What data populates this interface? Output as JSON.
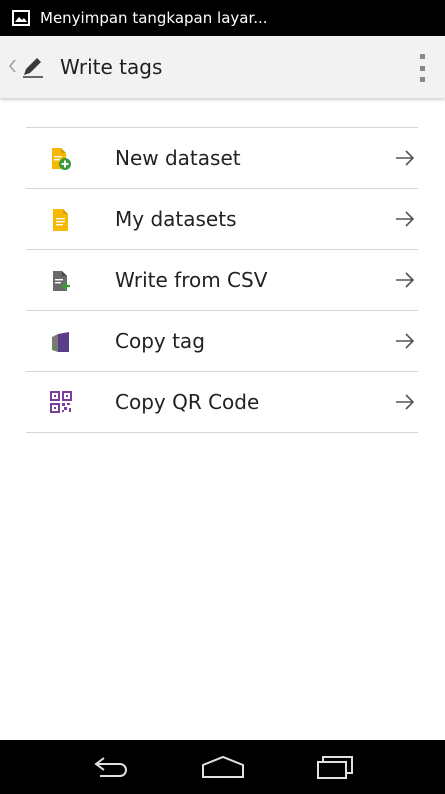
{
  "status_bar": {
    "text": "Menyimpan tangkapan layar...",
    "icon": "screenshot-icon"
  },
  "action_bar": {
    "title": "Write tags",
    "icon": "pencil-icon"
  },
  "menu": {
    "items": [
      {
        "label": "New dataset",
        "icon": "new-document-icon",
        "icon_color": "#f6b900",
        "badge_color": "#3a9b3a"
      },
      {
        "label": "My datasets",
        "icon": "document-icon",
        "icon_color": "#f6b900"
      },
      {
        "label": "Write from CSV",
        "icon": "csv-import-icon",
        "icon_color": "#6a6a6a",
        "badge_color": "#3a9b3a"
      },
      {
        "label": "Copy tag",
        "icon": "nfc-tag-icon",
        "icon_color": "#5a3d8a"
      },
      {
        "label": "Copy QR Code",
        "icon": "qr-code-icon",
        "icon_color": "#7a3f9d"
      }
    ]
  },
  "nav_bar": {
    "back": "back-icon",
    "home": "home-icon",
    "recents": "recents-icon"
  }
}
